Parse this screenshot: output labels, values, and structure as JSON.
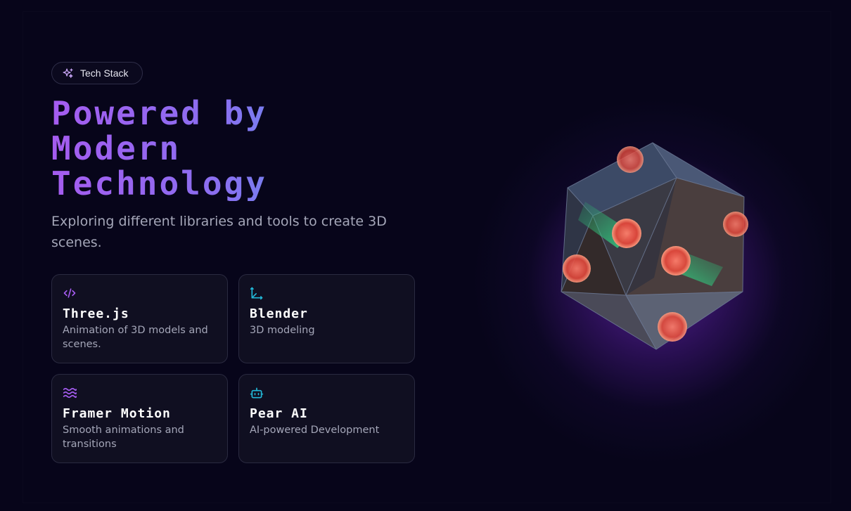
{
  "badge": {
    "label": "Tech Stack",
    "icon": "sparkles-icon"
  },
  "headline": {
    "line1": "Powered by",
    "line2": "Modern",
    "line3": "Technology"
  },
  "subtitle": "Exploring different libraries and tools to create 3D scenes.",
  "cards": [
    {
      "title": "Three.js",
      "description": "Animation of 3D models and scenes.",
      "icon": "code-icon",
      "icon_color": "#a55cf0"
    },
    {
      "title": "Blender",
      "description": "3D modeling",
      "icon": "axis-3d-icon",
      "icon_color": "#22b8d8"
    },
    {
      "title": "Framer Motion",
      "description": "Smooth animations and transitions",
      "icon": "waves-icon",
      "icon_color": "#a55cf0"
    },
    {
      "title": "Pear AI",
      "description": "AI-powered Development",
      "icon": "bot-icon",
      "icon_color": "#22b8d8"
    }
  ],
  "colors": {
    "background": "#07051a",
    "gradient_start": "#a55cf0",
    "gradient_end": "#4aa6ec",
    "glow": "#6224aa"
  }
}
